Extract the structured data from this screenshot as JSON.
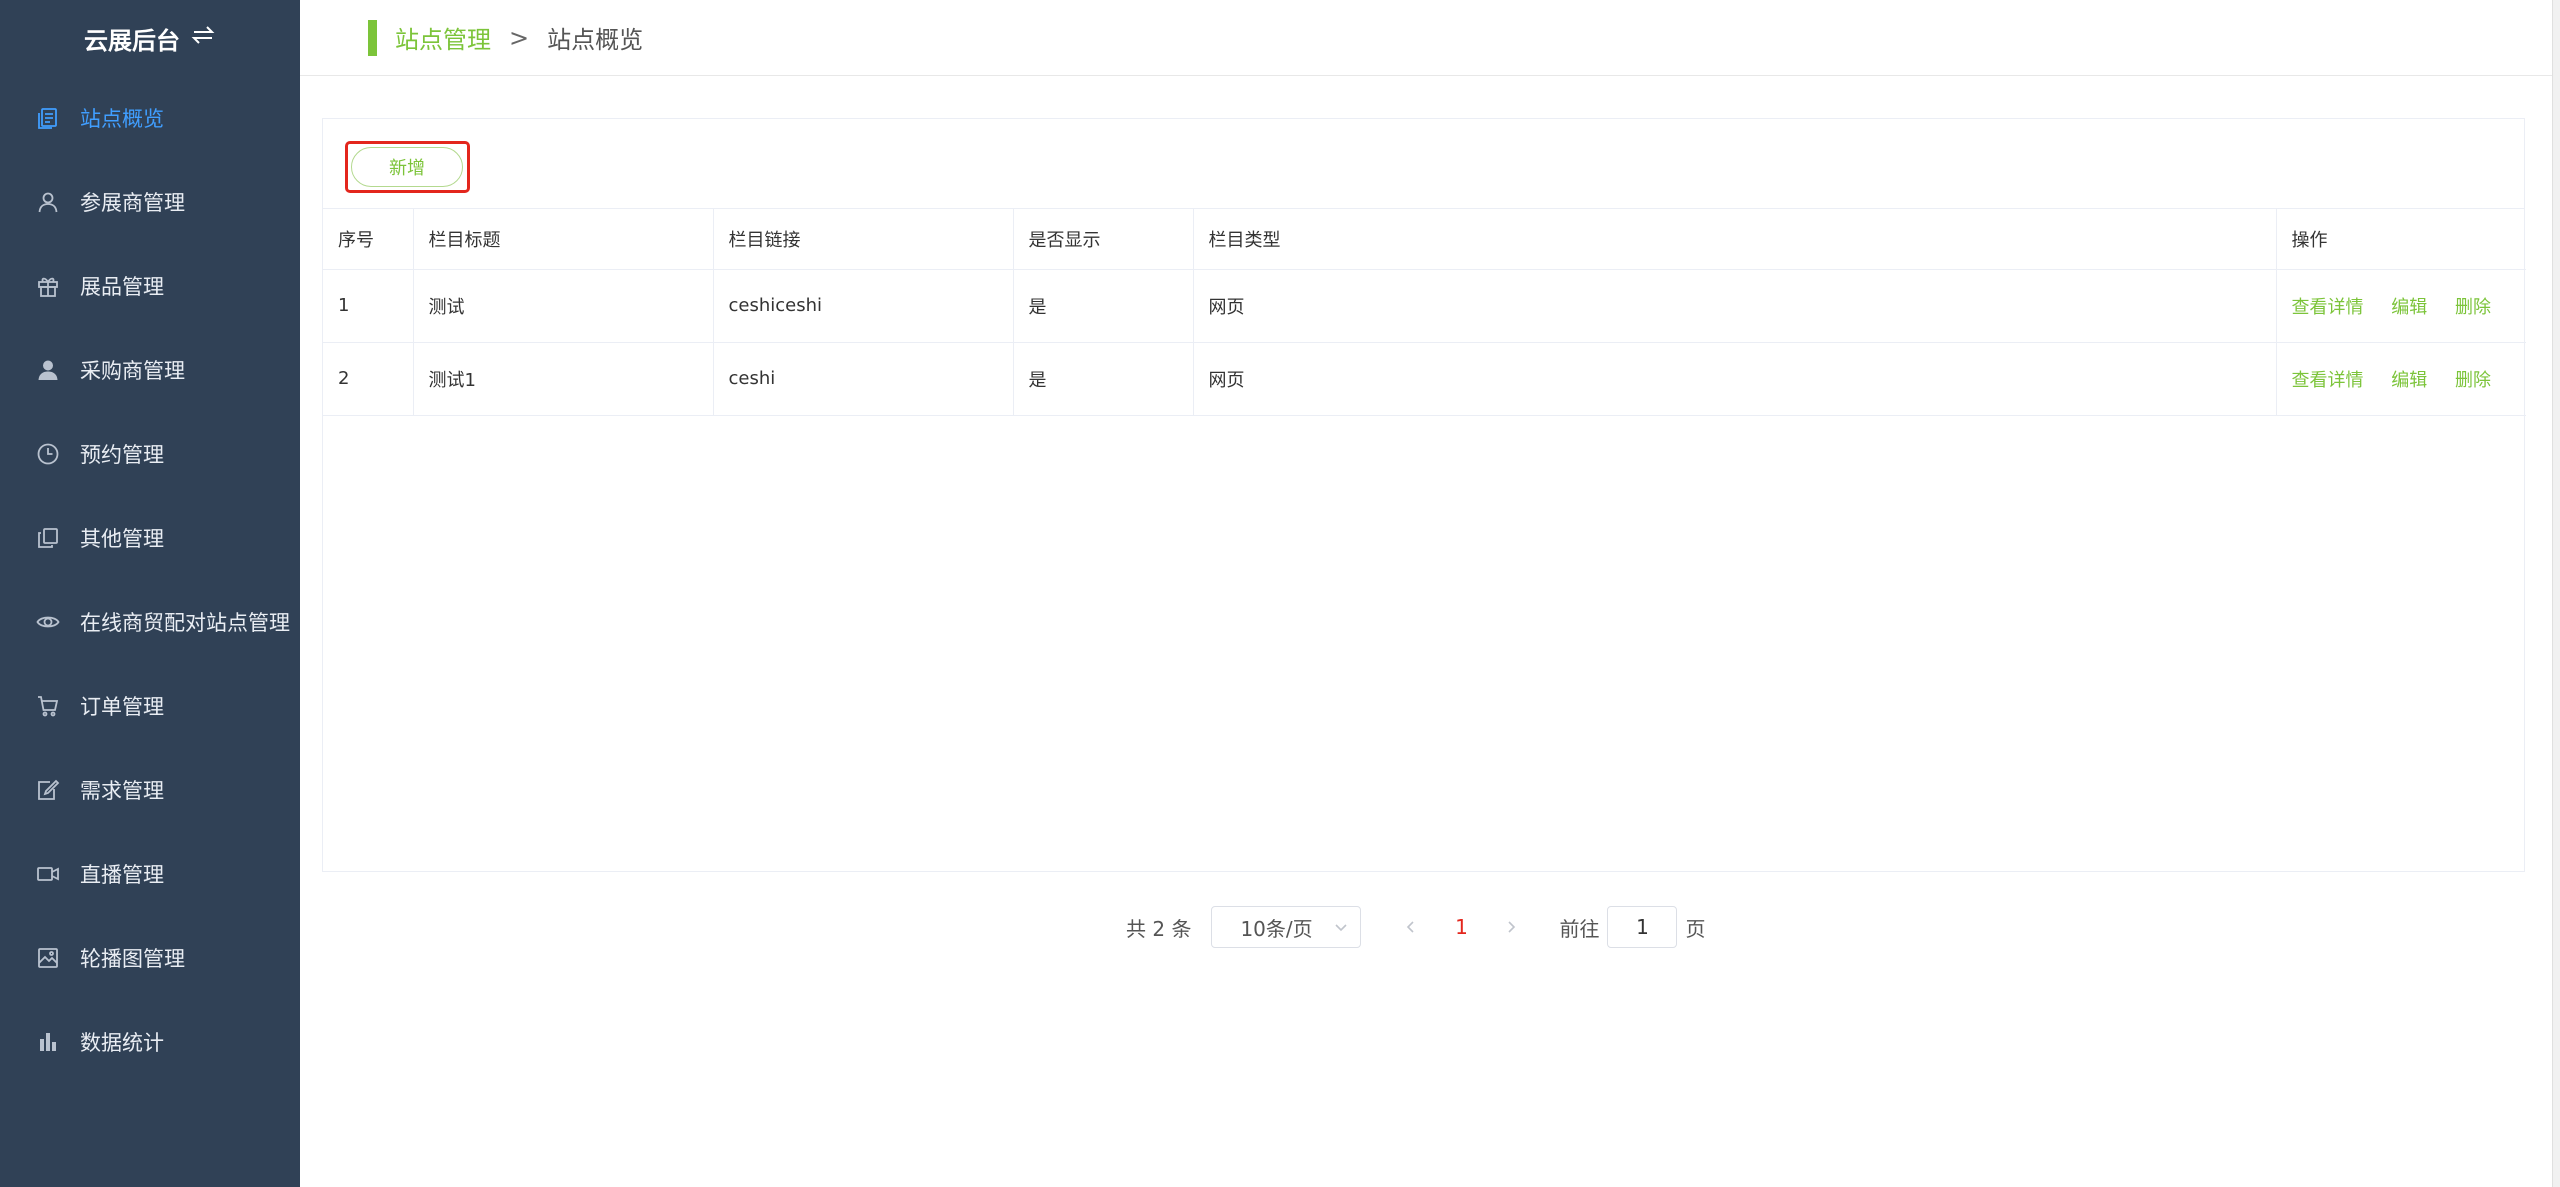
{
  "app": {
    "title": "云展后台",
    "switch_icon": "switch-icon"
  },
  "sidebar": {
    "items": [
      {
        "label": "站点概览",
        "icon": "document-icon",
        "active": true
      },
      {
        "label": "参展商管理",
        "icon": "user-outline-icon"
      },
      {
        "label": "展品管理",
        "icon": "gift-icon"
      },
      {
        "label": "采购商管理",
        "icon": "user-filled-icon"
      },
      {
        "label": "预约管理",
        "icon": "clock-icon"
      },
      {
        "label": "其他管理",
        "icon": "copy-icon"
      },
      {
        "label": "在线商贸配对站点管理",
        "icon": "eye-icon"
      },
      {
        "label": "订单管理",
        "icon": "cart-icon"
      },
      {
        "label": "需求管理",
        "icon": "edit-icon"
      },
      {
        "label": "直播管理",
        "icon": "video-camera-icon"
      },
      {
        "label": "轮播图管理",
        "icon": "picture-icon"
      },
      {
        "label": "数据统计",
        "icon": "bar-chart-icon"
      }
    ]
  },
  "breadcrumb": {
    "parent": "站点管理",
    "separator": ">",
    "current": "站点概览"
  },
  "toolbar": {
    "add_label": "新增"
  },
  "table": {
    "headers": [
      "序号",
      "栏目标题",
      "栏目链接",
      "是否显示",
      "栏目类型",
      "操作"
    ],
    "rows": [
      {
        "index": "1",
        "title": "测试",
        "link": "ceshiceshi",
        "visible": "是",
        "type": "网页"
      },
      {
        "index": "2",
        "title": "测试1",
        "link": "ceshi",
        "visible": "是",
        "type": "网页"
      }
    ],
    "actions": {
      "view": "查看详情",
      "edit": "编辑",
      "delete": "删除"
    }
  },
  "pagination": {
    "total_text": "共 2 条",
    "page_size": "10条/页",
    "current_page": "1",
    "goto_label": "前往",
    "goto_value": "1",
    "page_unit": "页"
  },
  "colors": {
    "sidebar_bg": "#304156",
    "accent_green": "#7cc43a",
    "active_blue": "#409eff",
    "highlight_red": "#e3261d"
  }
}
